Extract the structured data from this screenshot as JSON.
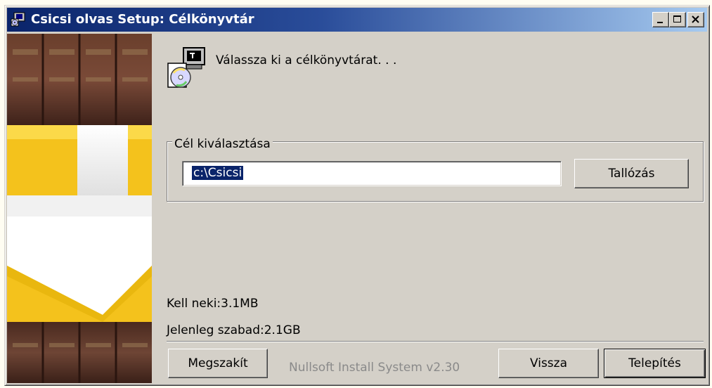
{
  "window": {
    "title": "Csicsi olvas Setup: Célkönyvtár"
  },
  "header": {
    "text": "Válassza ki a célkönyvtárat. . .",
    "icon": "setup-disk-icon"
  },
  "destination": {
    "group_label": "Cél kiválasztása",
    "path_value": "c:\\Csicsi",
    "browse_label": "Tallózás"
  },
  "space": {
    "required": "Kell neki:3.1MB",
    "available": "Jelenleg szabad:2.1GB"
  },
  "footer": {
    "branding": "Nullsoft Install System v2.30",
    "cancel_label": "Megszakít",
    "back_label": "Vissza",
    "install_label": "Telepítés"
  },
  "colors": {
    "title_gradient_start": "#0a246a",
    "title_gradient_end": "#a6caf0",
    "dialog_bg": "#d4d0c8",
    "selection_bg": "#0a246a",
    "banner_yellow": "#f4c21c"
  }
}
